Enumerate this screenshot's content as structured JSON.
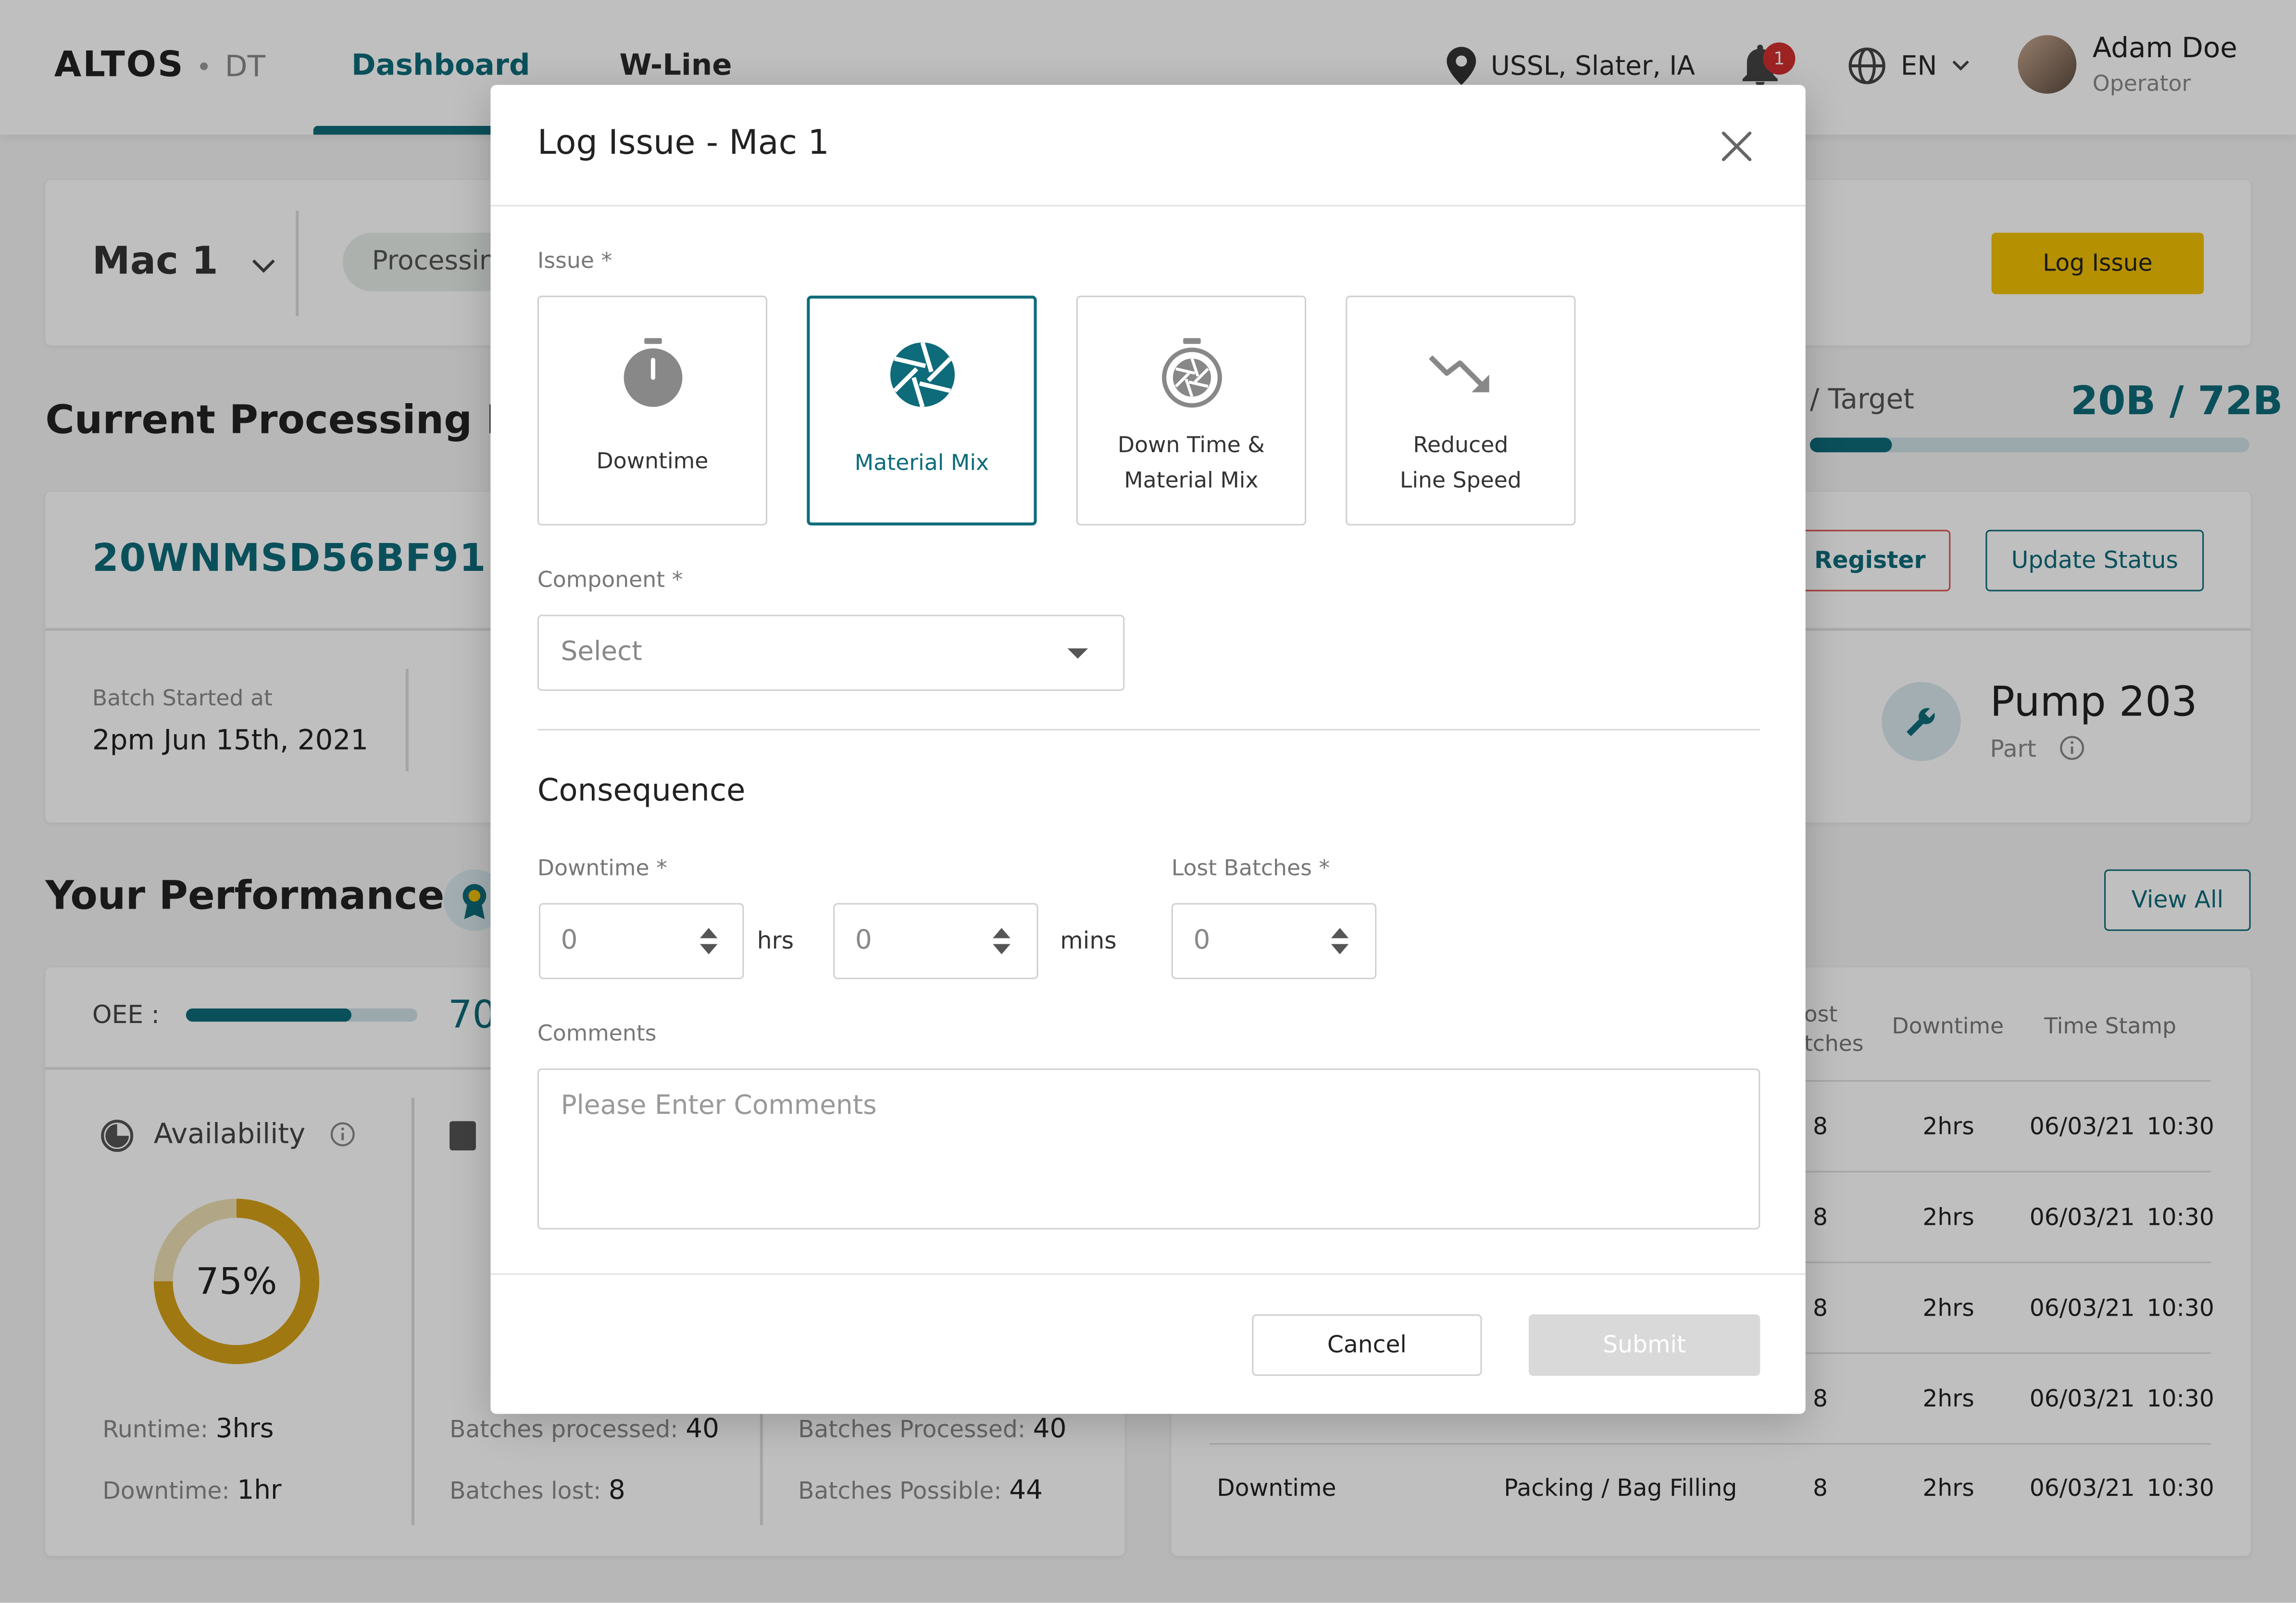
{
  "brand": {
    "name": "ALTOS",
    "suffix": "DT"
  },
  "nav": {
    "tabs": [
      "Dashboard",
      "W-Line"
    ],
    "active": "Dashboard"
  },
  "header": {
    "location": "USSL, Slater, IA",
    "notifications": "1",
    "language": "EN",
    "user": {
      "name": "Adam Doe",
      "role": "Operator"
    }
  },
  "machine": {
    "name": "Mac 1",
    "status": "Processing",
    "log_issue_label": "Log Issue"
  },
  "current_batch": {
    "heading": "Current Processing Batch",
    "target_label": "/ Target",
    "target_value": "20B / 72B",
    "target_progress": 0.19,
    "batch_id": "20WNMSD56BF91",
    "started_label": "Batch Started at",
    "started_value": "2pm Jun 15th, 2021",
    "register_label": "Register",
    "update_status_label": "Update Status",
    "part_name": "Pump 203",
    "part_label": "Part"
  },
  "performance": {
    "heading": "Your Performance",
    "view_all_label": "View All",
    "oee_label": "OEE :",
    "oee_value": "70",
    "oee_progress": 0.7,
    "availability_label": "Availability",
    "availability_percent": "75%",
    "availability_fraction": 0.75,
    "runtime_label": "Runtime:",
    "runtime_value": "3hrs",
    "downtime_label": "Downtime:",
    "downtime_value": "1hr",
    "batches_processed_label": "Batches processed:",
    "batches_processed_value": "40",
    "batches_lost_label": "Batches lost:",
    "batches_lost_value": "8",
    "batches_processed2_label": "Batches Processed:",
    "batches_processed2_value": "40",
    "batches_possible_label": "Batches Possible:",
    "batches_possible_value": "44"
  },
  "issue_table": {
    "headers": [
      "Lost Batches",
      "Downtime",
      "Time Stamp"
    ],
    "header_lost_line1": "ost",
    "header_lost_line2": "tches",
    "rows": [
      {
        "type": "",
        "component": "",
        "lost": "8",
        "downtime": "2hrs",
        "date": "06/03/21",
        "time": "10:30"
      },
      {
        "type": "",
        "component": "",
        "lost": "8",
        "downtime": "2hrs",
        "date": "06/03/21",
        "time": "10:30"
      },
      {
        "type": "",
        "component": "",
        "lost": "8",
        "downtime": "2hrs",
        "date": "06/03/21",
        "time": "10:30"
      },
      {
        "type": "",
        "component": "",
        "lost": "8",
        "downtime": "2hrs",
        "date": "06/03/21",
        "time": "10:30"
      },
      {
        "type": "Downtime",
        "component": "Packing / Bag Filling",
        "lost": "8",
        "downtime": "2hrs",
        "date": "06/03/21",
        "time": "10:30"
      }
    ]
  },
  "modal": {
    "title": "Log Issue - Mac 1",
    "issue_label": "Issue *",
    "issue_options": [
      {
        "label_line1": "Downtime",
        "label_line2": "",
        "icon": "stopwatch-icon",
        "selected": false
      },
      {
        "label_line1": "Material Mix",
        "label_line2": "",
        "icon": "aperture-icon",
        "selected": true
      },
      {
        "label_line1": "Down Time &",
        "label_line2": "Material Mix",
        "icon": "stopwatch-aperture-icon",
        "selected": false
      },
      {
        "label_line1": "Reduced",
        "label_line2": "Line Speed",
        "icon": "trend-down-icon",
        "selected": false
      }
    ],
    "component_label": "Component *",
    "component_placeholder": "Select",
    "consequence_heading": "Consequence",
    "downtime_label": "Downtime *",
    "downtime_hrs": "0",
    "hrs_unit": "hrs",
    "downtime_mins": "0",
    "mins_unit": "mins",
    "lost_batches_label": "Lost Batches *",
    "lost_batches": "0",
    "comments_label": "Comments",
    "comments_placeholder": "Please Enter Comments",
    "cancel_label": "Cancel",
    "submit_label": "Submit"
  },
  "colors": {
    "accent": "#0e6b7a",
    "brand_yellow": "#f2c100",
    "alert_red": "#d32f2f",
    "donut": "#d4a017"
  }
}
